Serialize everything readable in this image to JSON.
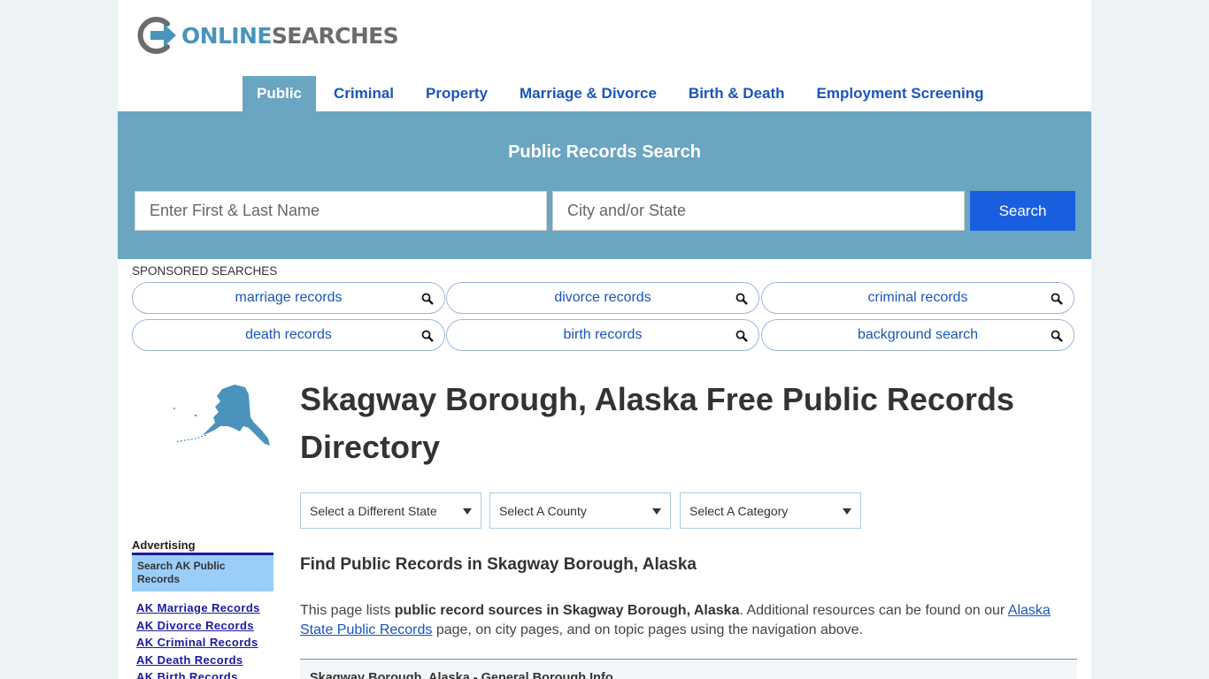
{
  "logo": {
    "text_a": "ONLINE",
    "text_b": "SEARCHES"
  },
  "nav": [
    {
      "label": "Public",
      "active": true
    },
    {
      "label": "Criminal"
    },
    {
      "label": "Property"
    },
    {
      "label": "Marriage & Divorce"
    },
    {
      "label": "Birth & Death"
    },
    {
      "label": "Employment Screening"
    }
  ],
  "search": {
    "title": "Public Records Search",
    "name_placeholder": "Enter First & Last Name",
    "location_placeholder": "City and/or State",
    "button": "Search"
  },
  "sponsored": {
    "label": "SPONSORED SEARCHES",
    "items": [
      "marriage records",
      "divorce records",
      "criminal records",
      "death records",
      "birth records",
      "background search"
    ]
  },
  "sidebar": {
    "advertising_label": "Advertising",
    "box_text": "Search AK Public Records",
    "links": [
      "AK Marriage Records",
      "AK Divorce Records",
      "AK Criminal Records",
      "AK Death Records",
      "AK Birth Records"
    ]
  },
  "main": {
    "title": "Skagway Borough, Alaska Free Public Records Directory",
    "selects": [
      "Select a Different State",
      "Select A County",
      "Select A Category"
    ],
    "subtitle": "Find Public Records in Skagway Borough, Alaska",
    "intro": {
      "pre": "This page lists ",
      "bold": "public record sources in Skagway Borough, Alaska",
      "mid": ". Additional resources can be found on our ",
      "link": "Alaska State Public Records",
      "post": " page, on city pages, and on topic pages using the navigation above."
    },
    "info_title": "Skagway Borough, Alaska - General Borough Info"
  },
  "colors": {
    "accent": "#6aa5c1",
    "link": "#1a55b8",
    "button": "#1a5ee0"
  }
}
